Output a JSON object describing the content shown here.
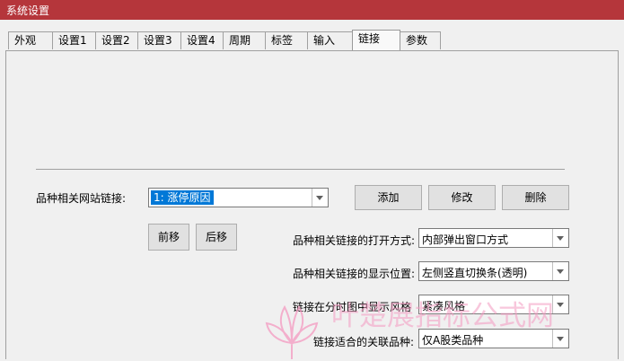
{
  "window": {
    "title": "系统设置"
  },
  "tabs": [
    {
      "label": "外观"
    },
    {
      "label": "设置1"
    },
    {
      "label": "设置2"
    },
    {
      "label": "设置3"
    },
    {
      "label": "设置4"
    },
    {
      "label": "周期"
    },
    {
      "label": "标签"
    },
    {
      "label": "输入"
    },
    {
      "label": "链接",
      "active": true
    },
    {
      "label": "参数"
    }
  ],
  "link_settings": {
    "site_link_label": "品种相关网站链接:",
    "site_link_value": "1: 涨停原因",
    "add_button": "添加",
    "edit_button": "修改",
    "delete_button": "删除",
    "move_up_button": "前移",
    "move_down_button": "后移",
    "open_mode_label": "品种相关链接的打开方式:",
    "open_mode_value": "内部弹出窗口方式",
    "display_position_label": "品种相关链接的显示位置:",
    "display_position_value": "左侧竖直切换条(透明)",
    "timeshare_label": "链接在分时图中显示风格",
    "timeshare_value": "紧凑风格",
    "applicable_label": "链接适合的关联品种:",
    "applicable_value": "仅A股类品种"
  },
  "watermark": {
    "text": "叶楚展指标公式网"
  },
  "colors": {
    "titlebar": "#b5363b",
    "selection": "#0078d7",
    "watermark": "#f49ac1"
  }
}
